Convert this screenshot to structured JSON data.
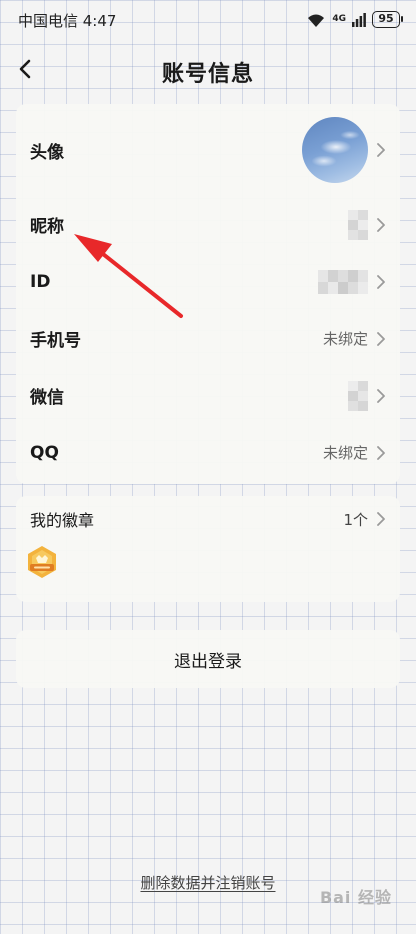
{
  "status_bar": {
    "carrier_time": "中国电信 4:47",
    "network": "4G",
    "battery": "95"
  },
  "header": {
    "title": "账号信息"
  },
  "profile": {
    "rows": [
      {
        "label": "头像",
        "value": ""
      },
      {
        "label": "昵称",
        "value": ""
      },
      {
        "label": "ID",
        "value": ""
      },
      {
        "label": "手机号",
        "value": "未绑定"
      },
      {
        "label": "微信",
        "value": ""
      },
      {
        "label": "QQ",
        "value": "未绑定"
      }
    ]
  },
  "badges": {
    "title": "我的徽章",
    "count": "1个"
  },
  "logout": {
    "label": "退出登录"
  },
  "delete_account": {
    "label": "删除数据并注销账号"
  },
  "watermark": {
    "text": "Bai 经验"
  },
  "colors": {
    "annotation_arrow": "#e8282a",
    "badge_gold": "#f3b33d"
  }
}
